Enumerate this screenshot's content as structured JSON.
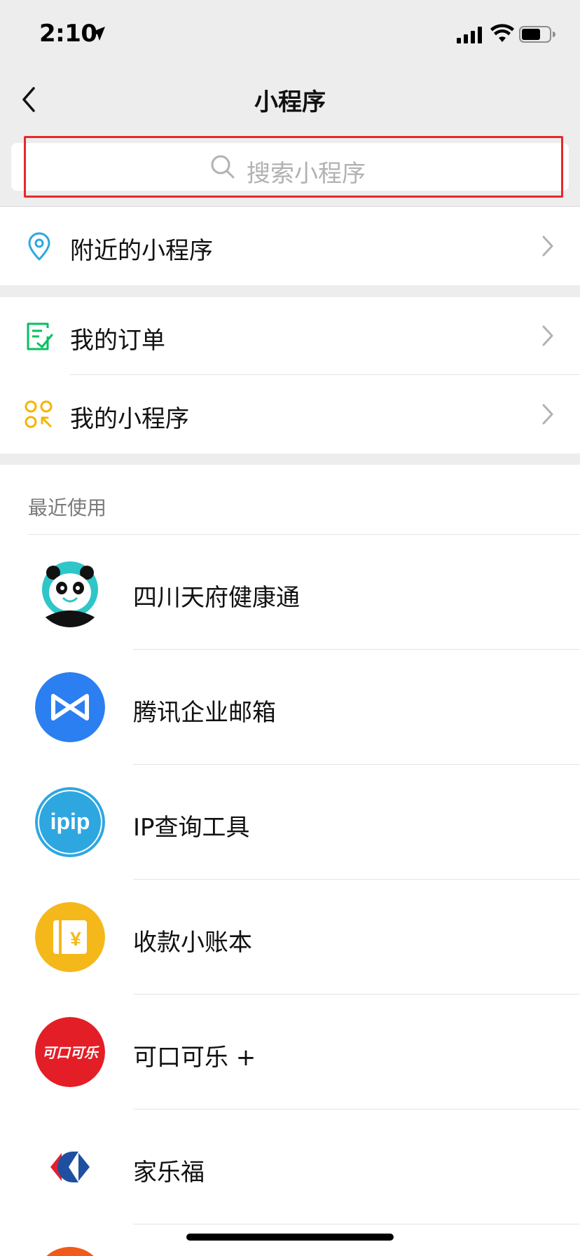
{
  "status_bar": {
    "time": "2:10"
  },
  "nav": {
    "title": "小程序"
  },
  "search": {
    "placeholder": "搜索小程序"
  },
  "menu": {
    "nearby": "附近的小程序",
    "orders": "我的订单",
    "my_mini_programs": "我的小程序"
  },
  "recent": {
    "header": "最近使用",
    "apps": [
      {
        "name": "四川天府健康通",
        "icon": "panda-icon"
      },
      {
        "name": "腾讯企业邮箱",
        "icon": "tencent-mail-icon"
      },
      {
        "name": "IP查询工具",
        "icon": "ipip-icon",
        "icon_text": "ipip"
      },
      {
        "name": "收款小账本",
        "icon": "ledger-icon",
        "icon_text": "¥"
      },
      {
        "name": "可口可乐 +",
        "icon": "coca-cola-icon",
        "icon_text": "可口可乐"
      },
      {
        "name": "家乐福",
        "icon": "carrefour-icon"
      }
    ]
  },
  "colors": {
    "background_gray": "#ededed",
    "highlight_red": "#e8282a",
    "nearby_blue": "#2ea7e0",
    "orders_green": "#07c160",
    "mini_yellow": "#f4b400"
  }
}
